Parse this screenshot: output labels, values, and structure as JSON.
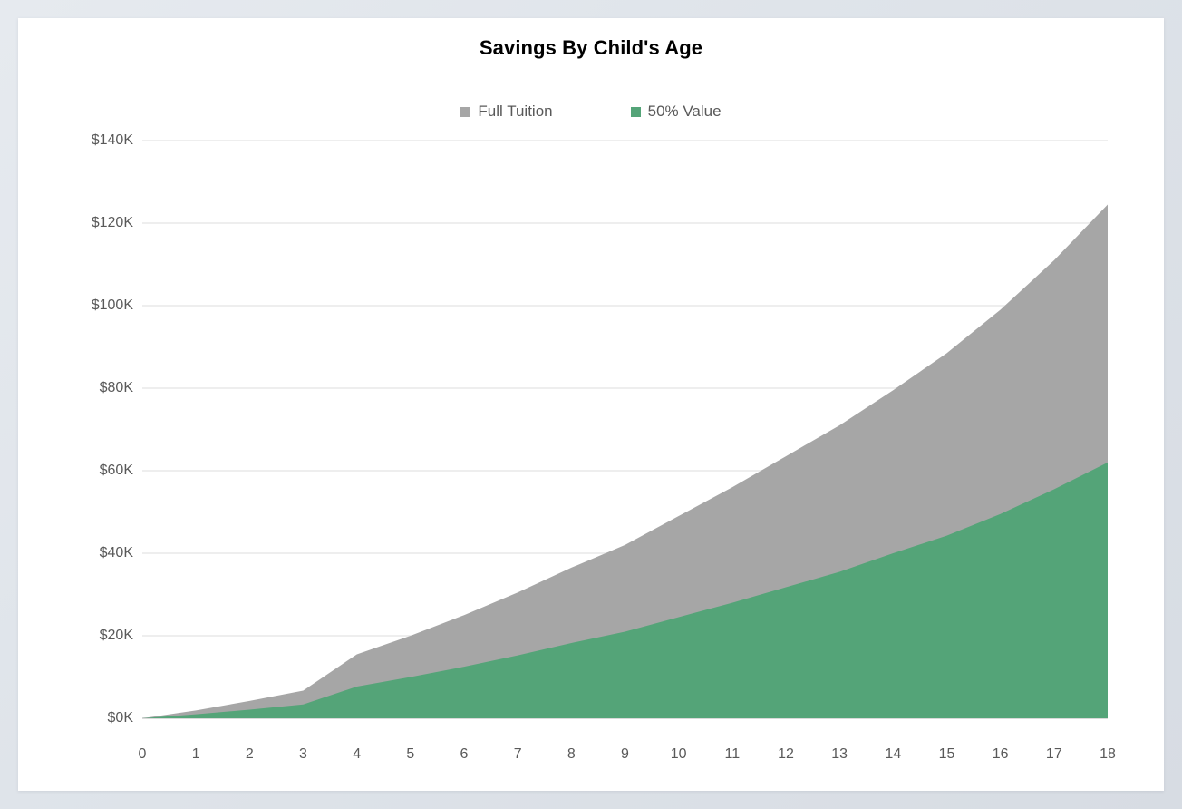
{
  "card": {
    "background_color": "#ffffff",
    "page_background_color": "#dfe4ea"
  },
  "chart_data": {
    "type": "area",
    "title": "Savings By Child's Age",
    "xlabel": "",
    "ylabel": "",
    "grid": true,
    "grid_color": "#e8e8e8",
    "legend_position": "top",
    "stacked": false,
    "x": [
      0,
      1,
      2,
      3,
      4,
      5,
      6,
      7,
      8,
      9,
      10,
      11,
      12,
      13,
      14,
      15,
      16,
      17,
      18
    ],
    "categories": [
      "0",
      "1",
      "2",
      "3",
      "4",
      "5",
      "6",
      "7",
      "8",
      "9",
      "10",
      "11",
      "12",
      "13",
      "14",
      "15",
      "16",
      "17",
      "18"
    ],
    "x_tick_labels": [
      "0",
      "1",
      "2",
      "3",
      "4",
      "5",
      "6",
      "7",
      "8",
      "9",
      "10",
      "11",
      "12",
      "13",
      "14",
      "15",
      "16",
      "17",
      "18"
    ],
    "y_tick_labels": [
      "$0K",
      "$20K",
      "$40K",
      "$60K",
      "$80K",
      "$100K",
      "$120K",
      "$140K"
    ],
    "y_tick_values": [
      0,
      20000,
      40000,
      60000,
      80000,
      100000,
      120000,
      140000
    ],
    "ylim": [
      0,
      140000
    ],
    "xlim": [
      0,
      18
    ],
    "series": [
      {
        "name": "Full Tuition",
        "color": "#a6a6a6",
        "values": [
          0,
          1900,
          4200,
          6700,
          15500,
          20000,
          25000,
          30500,
          36500,
          42000,
          49000,
          56000,
          63500,
          71000,
          79500,
          88500,
          99000,
          111000,
          124500
        ]
      },
      {
        "name": "50% Value",
        "color": "#54a478",
        "values": [
          0,
          950,
          2100,
          3350,
          7700,
          10000,
          12500,
          15250,
          18250,
          21000,
          24500,
          28000,
          31750,
          35500,
          40000,
          44250,
          49500,
          55500,
          62000
        ]
      }
    ],
    "legend": [
      {
        "label": "Full Tuition",
        "color": "#a6a6a6",
        "marker": "square"
      },
      {
        "label": "50% Value",
        "color": "#54a478",
        "marker": "square"
      }
    ]
  }
}
